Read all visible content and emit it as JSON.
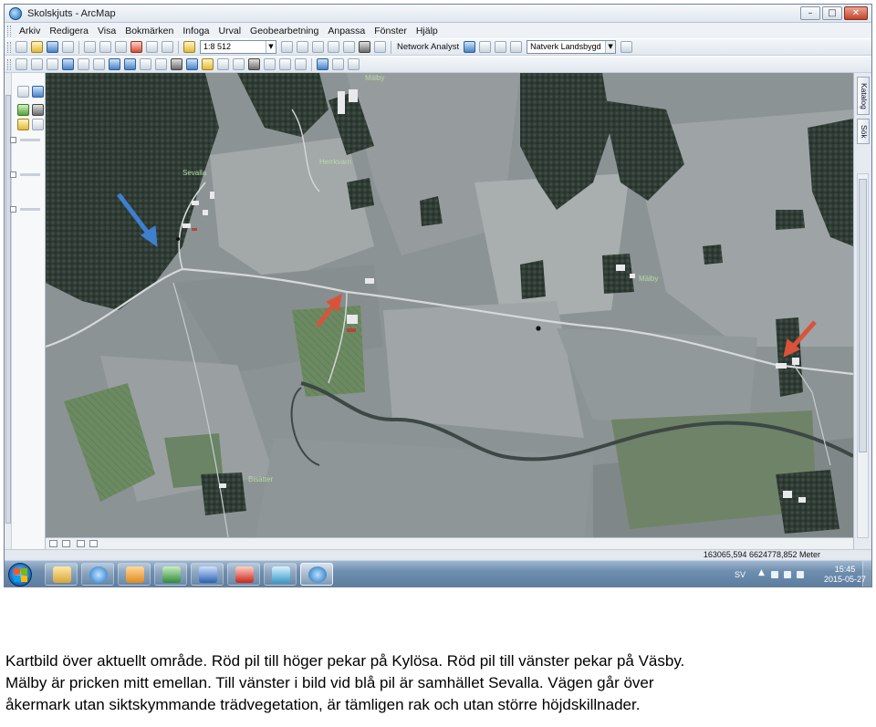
{
  "window": {
    "title": "Skolskjuts - ArcMap",
    "controls": {
      "minimize": "–",
      "maximize": "□",
      "close": "✕"
    }
  },
  "menu": [
    "Arkiv",
    "Redigera",
    "Visa",
    "Bokmärken",
    "Infoga",
    "Urval",
    "Geobearbetning",
    "Anpassa",
    "Fönster",
    "Hjälp"
  ],
  "toolbar": {
    "scale": "1:8 512",
    "network_analyst_label": "Network Analyst",
    "network_dataset": "Natverk Landsbygd"
  },
  "right_dock": {
    "tabs": [
      "Katalog",
      "Sök"
    ]
  },
  "map": {
    "labels": [
      "Mälby",
      "Herrkvarn",
      "Mälby",
      "Sevalla",
      "Bisätter"
    ],
    "arrow_colors": {
      "red": "#d9533a",
      "blue": "#3f7fcf"
    }
  },
  "status": {
    "coordinates": "163065,594  6624778,852 Meter"
  },
  "taskbar": {
    "language": "SV",
    "time": "15:45",
    "date": "2015-05-27",
    "apps": [
      "explorer-icon",
      "internet-explorer-icon",
      "outlook-icon",
      "excel-icon",
      "word-icon",
      "acrobat-icon",
      "network-app-icon",
      "arcmap-icon"
    ]
  },
  "caption": {
    "line1": "Kartbild över aktuellt område. Röd pil till höger pekar på Kylösa. Röd pil till vänster pekar på Väsby.",
    "line2": "Mälby är pricken mitt emellan. Till vänster i bild vid blå pil är samhället Sevalla. Vägen går över",
    "line3": "åkermark utan siktskymmande trädvegetation, är tämligen rak och utan större höjdskillnader."
  }
}
